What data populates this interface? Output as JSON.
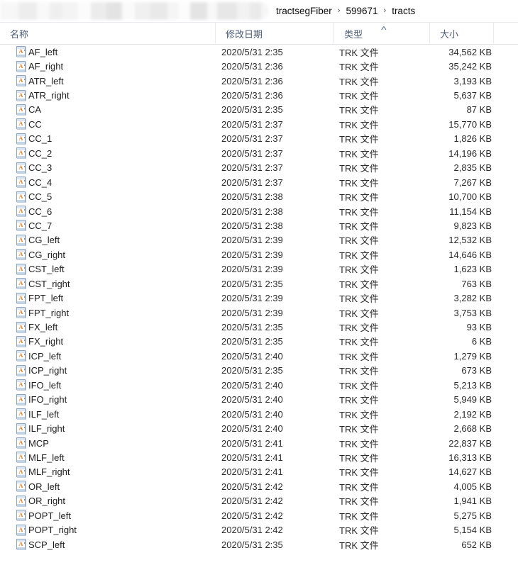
{
  "window": {
    "addressbar": {
      "redacted_path_placeholder": "",
      "breadcrumbs": [
        "tractsegFiber",
        "599671",
        "tracts"
      ],
      "separator": "›"
    }
  },
  "columns": {
    "headers": [
      {
        "key": "name",
        "label": "名称",
        "sorted": false
      },
      {
        "key": "date",
        "label": "修改日期",
        "sorted": false
      },
      {
        "key": "type",
        "label": "类型",
        "sorted": true
      },
      {
        "key": "size",
        "label": "大小",
        "sorted": false
      }
    ],
    "sort_caret": "˄"
  },
  "icons": {
    "file_icon_name": "trk-file-icon",
    "file_icon_glyph": "A",
    "file_icon_accent": "#e8821e"
  },
  "files": [
    {
      "name": "AF_left",
      "date": "2020/5/31 2:35",
      "type": "TRK 文件",
      "size": "34,562 KB"
    },
    {
      "name": "AF_right",
      "date": "2020/5/31 2:36",
      "type": "TRK 文件",
      "size": "35,242 KB"
    },
    {
      "name": "ATR_left",
      "date": "2020/5/31 2:36",
      "type": "TRK 文件",
      "size": "3,193 KB"
    },
    {
      "name": "ATR_right",
      "date": "2020/5/31 2:36",
      "type": "TRK 文件",
      "size": "5,637 KB"
    },
    {
      "name": "CA",
      "date": "2020/5/31 2:35",
      "type": "TRK 文件",
      "size": "87 KB"
    },
    {
      "name": "CC",
      "date": "2020/5/31 2:37",
      "type": "TRK 文件",
      "size": "15,770 KB"
    },
    {
      "name": "CC_1",
      "date": "2020/5/31 2:37",
      "type": "TRK 文件",
      "size": "1,826 KB"
    },
    {
      "name": "CC_2",
      "date": "2020/5/31 2:37",
      "type": "TRK 文件",
      "size": "14,196 KB"
    },
    {
      "name": "CC_3",
      "date": "2020/5/31 2:37",
      "type": "TRK 文件",
      "size": "2,835 KB"
    },
    {
      "name": "CC_4",
      "date": "2020/5/31 2:37",
      "type": "TRK 文件",
      "size": "7,267 KB"
    },
    {
      "name": "CC_5",
      "date": "2020/5/31 2:38",
      "type": "TRK 文件",
      "size": "10,700 KB"
    },
    {
      "name": "CC_6",
      "date": "2020/5/31 2:38",
      "type": "TRK 文件",
      "size": "11,154 KB"
    },
    {
      "name": "CC_7",
      "date": "2020/5/31 2:38",
      "type": "TRK 文件",
      "size": "9,823 KB"
    },
    {
      "name": "CG_left",
      "date": "2020/5/31 2:39",
      "type": "TRK 文件",
      "size": "12,532 KB"
    },
    {
      "name": "CG_right",
      "date": "2020/5/31 2:39",
      "type": "TRK 文件",
      "size": "14,646 KB"
    },
    {
      "name": "CST_left",
      "date": "2020/5/31 2:39",
      "type": "TRK 文件",
      "size": "1,623 KB"
    },
    {
      "name": "CST_right",
      "date": "2020/5/31 2:35",
      "type": "TRK 文件",
      "size": "763 KB"
    },
    {
      "name": "FPT_left",
      "date": "2020/5/31 2:39",
      "type": "TRK 文件",
      "size": "3,282 KB"
    },
    {
      "name": "FPT_right",
      "date": "2020/5/31 2:39",
      "type": "TRK 文件",
      "size": "3,753 KB"
    },
    {
      "name": "FX_left",
      "date": "2020/5/31 2:35",
      "type": "TRK 文件",
      "size": "93 KB"
    },
    {
      "name": "FX_right",
      "date": "2020/5/31 2:35",
      "type": "TRK 文件",
      "size": "6 KB"
    },
    {
      "name": "ICP_left",
      "date": "2020/5/31 2:40",
      "type": "TRK 文件",
      "size": "1,279 KB"
    },
    {
      "name": "ICP_right",
      "date": "2020/5/31 2:35",
      "type": "TRK 文件",
      "size": "673 KB"
    },
    {
      "name": "IFO_left",
      "date": "2020/5/31 2:40",
      "type": "TRK 文件",
      "size": "5,213 KB"
    },
    {
      "name": "IFO_right",
      "date": "2020/5/31 2:40",
      "type": "TRK 文件",
      "size": "5,949 KB"
    },
    {
      "name": "ILF_left",
      "date": "2020/5/31 2:40",
      "type": "TRK 文件",
      "size": "2,192 KB"
    },
    {
      "name": "ILF_right",
      "date": "2020/5/31 2:40",
      "type": "TRK 文件",
      "size": "2,668 KB"
    },
    {
      "name": "MCP",
      "date": "2020/5/31 2:41",
      "type": "TRK 文件",
      "size": "22,837 KB"
    },
    {
      "name": "MLF_left",
      "date": "2020/5/31 2:41",
      "type": "TRK 文件",
      "size": "16,313 KB"
    },
    {
      "name": "MLF_right",
      "date": "2020/5/31 2:41",
      "type": "TRK 文件",
      "size": "14,627 KB"
    },
    {
      "name": "OR_left",
      "date": "2020/5/31 2:42",
      "type": "TRK 文件",
      "size": "4,005 KB"
    },
    {
      "name": "OR_right",
      "date": "2020/5/31 2:42",
      "type": "TRK 文件",
      "size": "1,941 KB"
    },
    {
      "name": "POPT_left",
      "date": "2020/5/31 2:42",
      "type": "TRK 文件",
      "size": "5,275 KB"
    },
    {
      "name": "POPT_right",
      "date": "2020/5/31 2:42",
      "type": "TRK 文件",
      "size": "5,154 KB"
    },
    {
      "name": "SCP_left",
      "date": "2020/5/31 2:35",
      "type": "TRK 文件",
      "size": "652 KB"
    }
  ]
}
